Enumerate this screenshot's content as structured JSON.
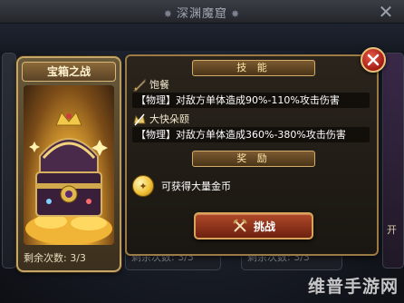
{
  "header": {
    "title": "深渊魔窟"
  },
  "treasure_card": {
    "title": "宝箱之战",
    "remaining": "剩余次数: 3/3"
  },
  "background_cards": {
    "mid_remaining": "剩余次数: 3/3",
    "mid2_remaining": "剩余次数: 3/3",
    "right_partial": "开"
  },
  "panel": {
    "skills_header": "技 能",
    "skills": [
      {
        "name": "饱餐",
        "description": "【物理】对敌方单体造成90%-110%攻击伤害",
        "icon": "sword-icon"
      },
      {
        "name": "大快朵颐",
        "description": "【物理】对敌方单体造成360%-380%攻击伤害",
        "icon": "crown-slash-icon"
      }
    ],
    "rewards_header": "奖 励",
    "reward_text": "可获得大量金币",
    "challenge_label": "挑战"
  },
  "watermark": "维普手游网",
  "colors": {
    "accent_gold": "#d2ad6a",
    "button_red": "#b04a2a",
    "close_red": "#a21a12"
  }
}
